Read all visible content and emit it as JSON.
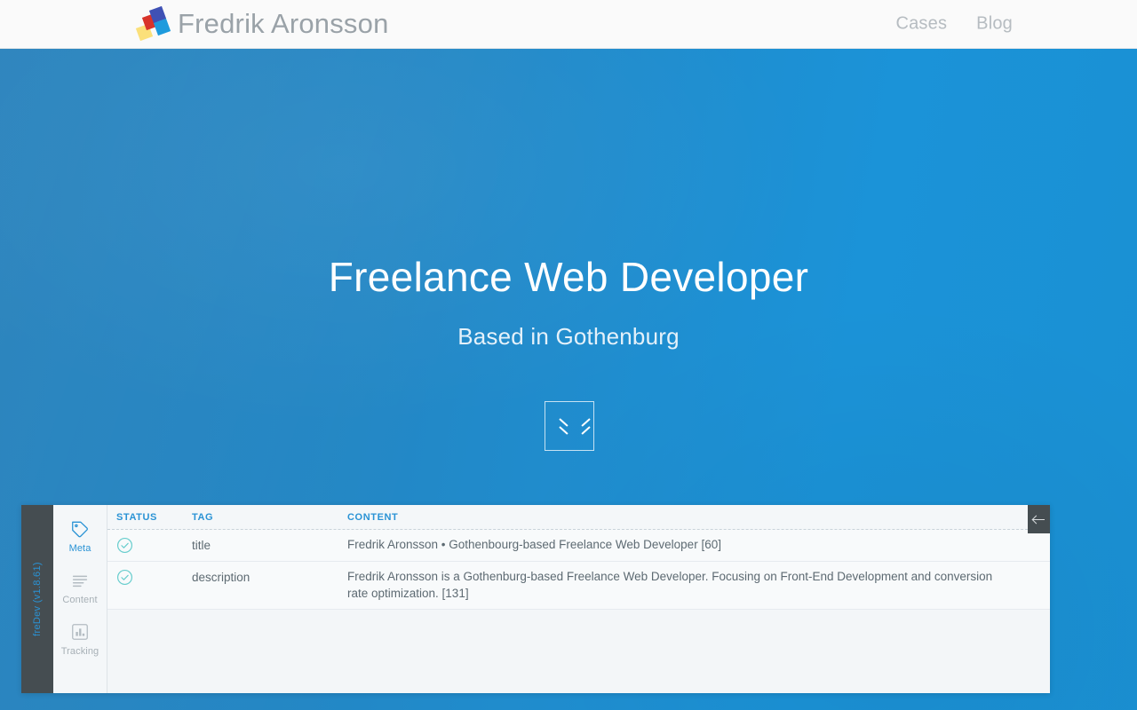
{
  "header": {
    "brand_name": "Fredrik Aronsson",
    "logo_colors": {
      "yellow": "#fbe07a",
      "red": "#d8332a",
      "purple": "#3f51b5",
      "blue": "#1e9bdd"
    },
    "nav": [
      {
        "label": "Cases"
      },
      {
        "label": "Blog"
      }
    ]
  },
  "hero": {
    "title": "Freelance Web Developer",
    "subtitle": "Based in Gothenburg",
    "scroll_button_icon": "double-chevron-down-icon",
    "background_color": "#1d8ccd"
  },
  "dev_panel": {
    "rail_label": "freDev (v1.8.61)",
    "accent_color": "#2a93d5",
    "tabs": [
      {
        "label": "Meta",
        "icon": "tag-icon",
        "active": true
      },
      {
        "label": "Content",
        "icon": "lines-icon",
        "active": false
      },
      {
        "label": "Tracking",
        "icon": "bar-chart-icon",
        "active": false
      }
    ],
    "columns": {
      "status": "STATUS",
      "tag": "TAG",
      "content": "CONTENT"
    },
    "rows": [
      {
        "status_icon": "check-circle-icon",
        "tag": "title",
        "content": "Fredrik Aronsson • Gothenbourg-based Freelance Web Developer [60]"
      },
      {
        "status_icon": "check-circle-icon",
        "tag": "description",
        "content": "Fredrik Aronsson is a Gothenburg-based Freelance Web Developer. Focusing on Front-End Development and conversion rate optimization. [131]"
      }
    ],
    "collapse_button_icon": "arrow-left-icon"
  }
}
